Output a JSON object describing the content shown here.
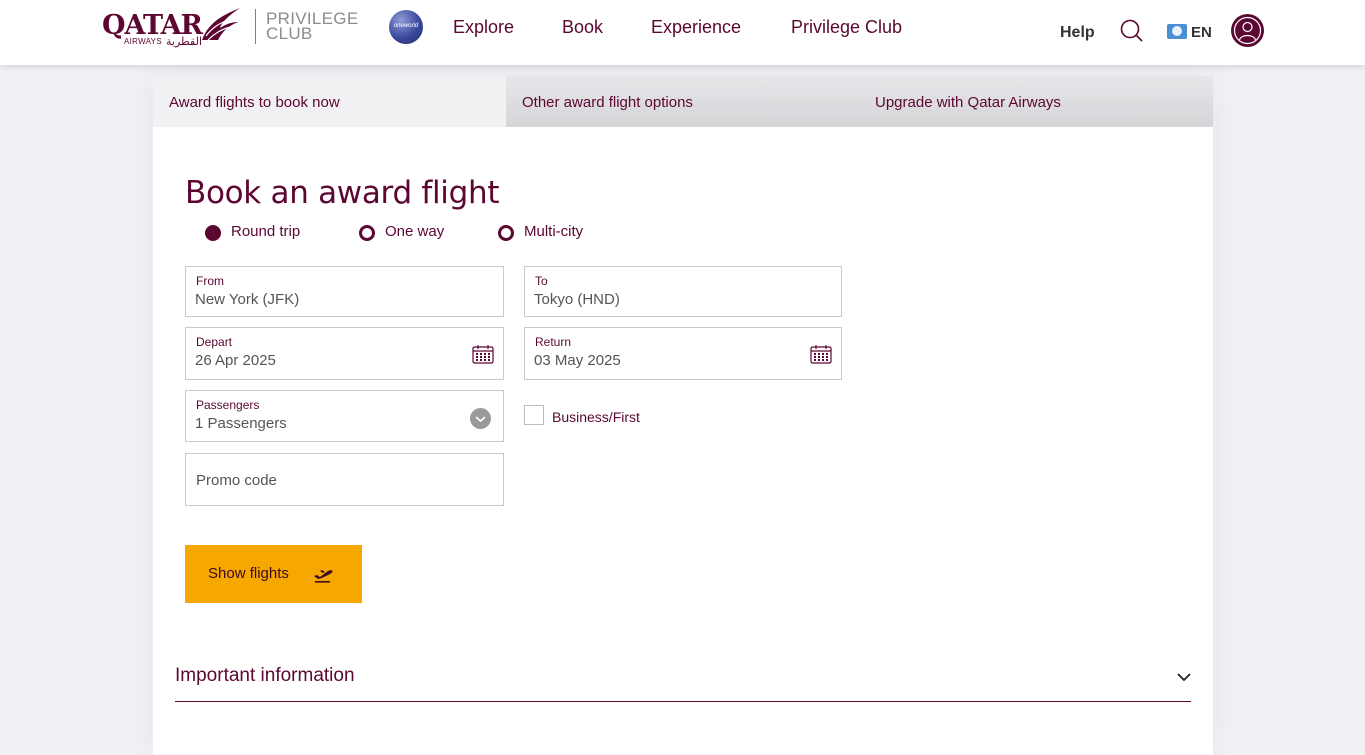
{
  "header": {
    "logo": {
      "name": "QATAR",
      "sub": "AIRWAYS",
      "sub_ar": "القطرية"
    },
    "program": {
      "line1": "PRIVILEGE",
      "line2": "CLUB"
    },
    "alliance_badge": "oneworld",
    "nav": [
      "Explore",
      "Book",
      "Experience",
      "Privilege Club"
    ],
    "help": "Help",
    "language": "EN",
    "icons": {
      "search": "search-icon",
      "language": "globe-icon",
      "profile": "user-icon"
    }
  },
  "tabs": [
    {
      "label": "Award flights to book now",
      "active": true
    },
    {
      "label": "Other award flight options",
      "active": false
    },
    {
      "label": "Upgrade with Qatar Airways",
      "active": false
    }
  ],
  "form": {
    "title": "Book an award flight",
    "trip_types": [
      {
        "label": "Round trip",
        "selected": true
      },
      {
        "label": "One way",
        "selected": false
      },
      {
        "label": "Multi-city",
        "selected": false
      }
    ],
    "from": {
      "label": "From",
      "value": "New York (JFK)"
    },
    "to": {
      "label": "To",
      "value": "Tokyo (HND)"
    },
    "depart": {
      "label": "Depart",
      "value": "26 Apr 2025"
    },
    "return": {
      "label": "Return",
      "value": "03 May 2025"
    },
    "passengers": {
      "label": "Passengers",
      "value": "1 Passengers"
    },
    "cabin_option": {
      "label": "Business/First",
      "checked": false
    },
    "promo": {
      "placeholder": "Promo code"
    },
    "submit": "Show flights"
  },
  "important_info": {
    "label": "Important information",
    "expanded": false
  },
  "colors": {
    "brand": "#5c0632",
    "accent": "#f7a800",
    "background": "#f1f1f5"
  }
}
